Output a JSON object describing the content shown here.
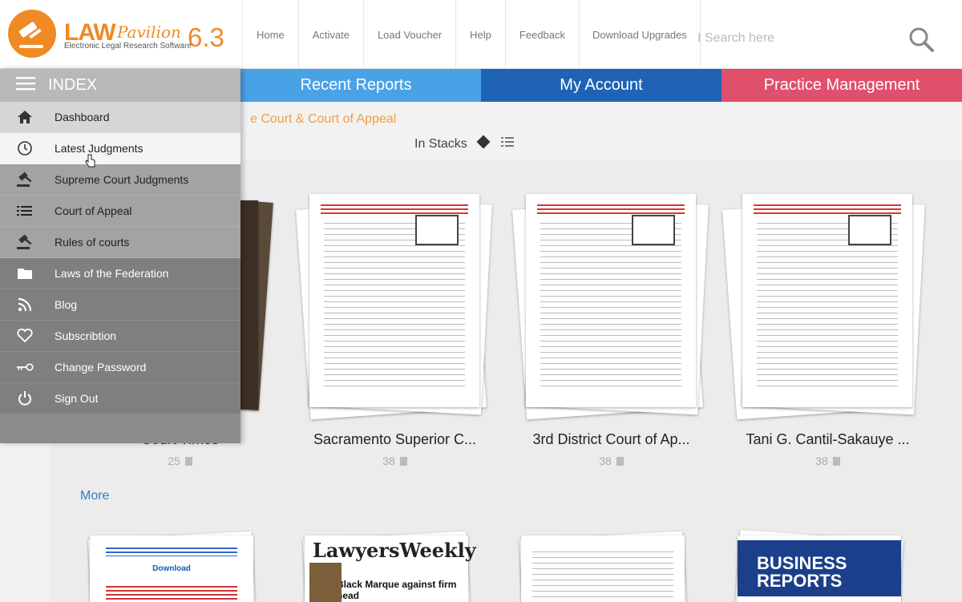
{
  "brand": {
    "name": "LAW",
    "script": "Pavilion",
    "version": "6.3",
    "subtitle": "Electronic Legal Research Software",
    "color": "#f08a24"
  },
  "header": {
    "links": [
      "Home",
      "Activate",
      "Load Voucher",
      "Help",
      "Feedback",
      "Download Upgrades"
    ],
    "search_placeholder": "I Search here"
  },
  "tabs": {
    "recent": "Recent Reports",
    "account": "My Account",
    "practice": "Practice Management"
  },
  "colors": {
    "recent": "#4aa2e6",
    "account": "#1e63b5",
    "practice": "#e04f6c"
  },
  "main": {
    "breadcrumb": "e Court & Court of Appeal",
    "view_mode": "In Stacks",
    "more_label": "More",
    "cards": [
      {
        "title": "Court Times",
        "count": "25"
      },
      {
        "title": "Sacramento Superior C...",
        "count": "38"
      },
      {
        "title": "3rd District Court of Ap...",
        "count": "38"
      },
      {
        "title": "Tani G. Cantil-Sakauye ...",
        "count": "38"
      }
    ],
    "row2": {
      "doc1_title": "Download",
      "doc2_title": "LawyersWeekly",
      "doc2_headline": "Black Marque against firm head",
      "doc4_title": "BUSINESS REPORTS"
    }
  },
  "sidebar": {
    "title": "INDEX",
    "items": [
      {
        "label": "Dashboard",
        "icon": "home-icon"
      },
      {
        "label": "Latest Judgments",
        "icon": "clock-icon"
      },
      {
        "label": "Supreme Court Judgments",
        "icon": "gavel-icon"
      },
      {
        "label": "Court of Appeal",
        "icon": "list-icon"
      },
      {
        "label": "Rules of courts",
        "icon": "gavel-icon"
      },
      {
        "label": "Laws of the Federation",
        "icon": "folder-icon"
      },
      {
        "label": "Blog",
        "icon": "rss-icon"
      },
      {
        "label": "Subscribtion",
        "icon": "heart-icon"
      },
      {
        "label": "Change Password",
        "icon": "key-icon"
      },
      {
        "label": "Sign Out",
        "icon": "power-icon"
      }
    ]
  }
}
